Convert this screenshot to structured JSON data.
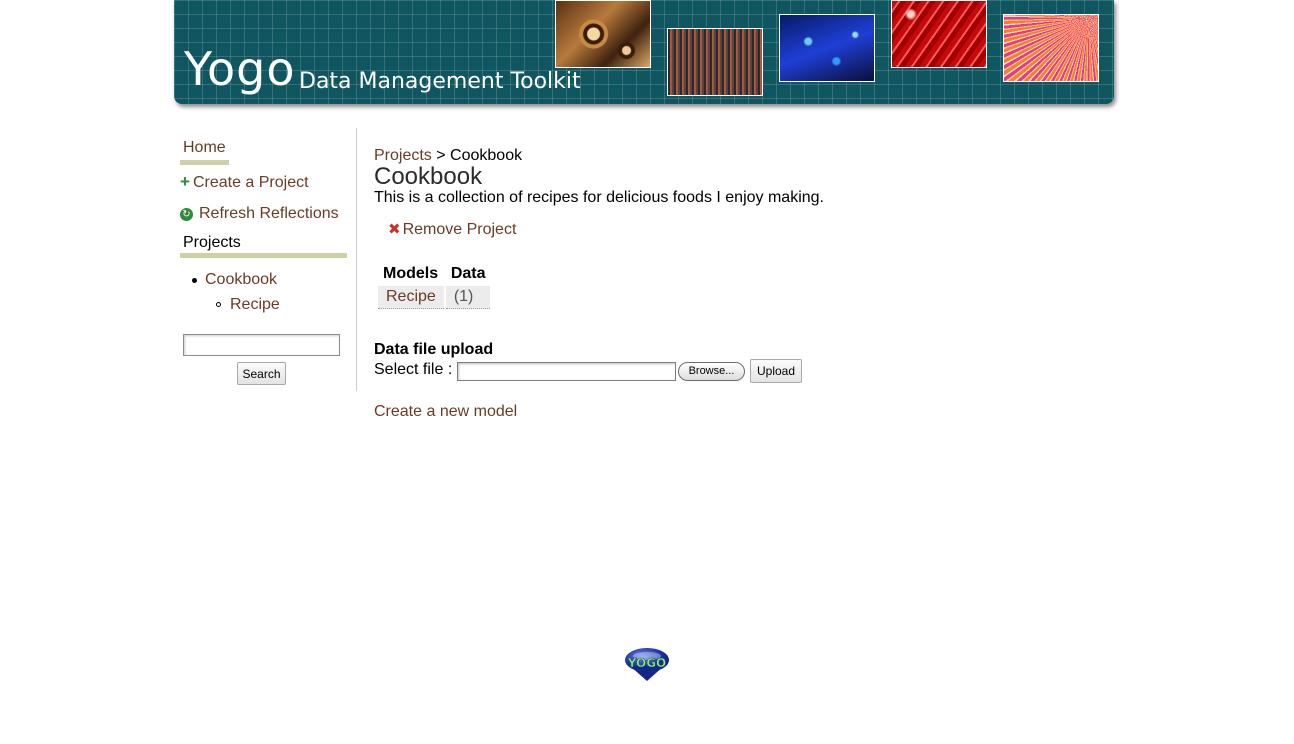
{
  "header": {
    "brand": "Yogo",
    "tagline": "Data Management Toolkit",
    "images": [
      "butterfly-wing-image",
      "spectrogram-image",
      "blue-circuit-image",
      "red-fibers-image",
      "fan-fibers-image"
    ]
  },
  "sidebar": {
    "home": "Home",
    "create_project": "Create a Project",
    "refresh_reflections": "Refresh Reflections",
    "projects_heading": "Projects",
    "projects": [
      {
        "label": "Cookbook",
        "models": [
          {
            "label": "Recipe"
          }
        ]
      }
    ],
    "search": {
      "value": "",
      "button_label": "Search"
    }
  },
  "main": {
    "breadcrumb": {
      "parent": "Projects",
      "separator": ">",
      "current": "Cookbook"
    },
    "title": "Cookbook",
    "description": "This is a collection of recipes for delicious foods I enjoy making.",
    "remove_label": "Remove Project",
    "models_table": {
      "headers": [
        "Models",
        "Data"
      ],
      "rows": [
        {
          "model": "Recipe",
          "count": "(1)"
        }
      ]
    },
    "upload": {
      "heading": "Data file upload",
      "select_label": "Select file :",
      "browse_label": "Browse...",
      "upload_label": "Upload"
    },
    "create_model_label": "Create a new model"
  },
  "footer": {
    "logo_text": "YOGO"
  },
  "colors": {
    "banner_bg": "#0f5661",
    "link": "#6b3b24",
    "accent_underline": "#cfd0a4",
    "add_icon": "#2f8a3a",
    "remove_icon": "#c0392b",
    "logo_blue": "#1c36a8"
  }
}
